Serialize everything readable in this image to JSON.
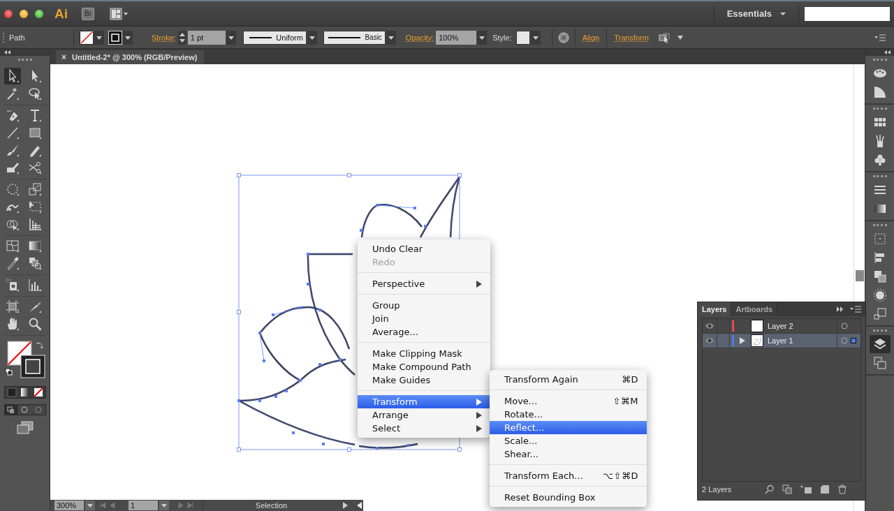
{
  "app": {
    "logo": "Ai",
    "bridge_button": "Br"
  },
  "workspace": {
    "label": "Essentials"
  },
  "control_bar": {
    "selection_label": "Path",
    "stroke_label": "Stroke:",
    "stroke_weight": "1 pt",
    "variable_width": "Uniform",
    "brush": "Basic",
    "opacity_label": "Opacity:",
    "opacity": "100%",
    "style_label": "Style:",
    "align_link": "Align",
    "transform_link": "Transform"
  },
  "tool_groups": [
    {
      "tools": [
        {
          "kind": "selection",
          "selected": true
        },
        {
          "kind": "direct-selection",
          "selected": false
        },
        {
          "kind": "magic-wand",
          "selected": false
        },
        {
          "kind": "lasso",
          "selected": false
        }
      ]
    },
    {
      "tools": [
        {
          "kind": "pen",
          "selected": false
        },
        {
          "kind": "type",
          "selected": false
        },
        {
          "kind": "line",
          "selected": false
        },
        {
          "kind": "rectangle",
          "selected": false
        },
        {
          "kind": "paintbrush",
          "selected": false
        },
        {
          "kind": "pencil",
          "selected": false
        },
        {
          "kind": "blob-brush",
          "selected": false
        },
        {
          "kind": "scissors",
          "selected": false
        }
      ]
    },
    {
      "tools": [
        {
          "kind": "rotate",
          "selected": false
        },
        {
          "kind": "scale",
          "selected": false
        },
        {
          "kind": "warp",
          "selected": false
        },
        {
          "kind": "free-transform",
          "selected": false
        },
        {
          "kind": "shape-builder",
          "selected": false
        },
        {
          "kind": "perspective-grid",
          "selected": false
        }
      ]
    },
    {
      "tools": [
        {
          "kind": "mesh",
          "selected": false
        },
        {
          "kind": "gradient",
          "selected": false
        },
        {
          "kind": "eyedropper",
          "selected": false
        },
        {
          "kind": "blend",
          "selected": false
        }
      ]
    },
    {
      "tools": [
        {
          "kind": "symbol-sprayer",
          "selected": false
        },
        {
          "kind": "column-graph",
          "selected": false
        }
      ]
    },
    {
      "tools": [
        {
          "kind": "artboard",
          "selected": false
        },
        {
          "kind": "slice",
          "selected": false
        },
        {
          "kind": "hand",
          "selected": false
        },
        {
          "kind": "zoom",
          "selected": false
        }
      ]
    }
  ],
  "document_tab": {
    "close": "×",
    "title": "Untitled-2* @ 300% (RGB/Preview)"
  },
  "context_menu": {
    "groups": [
      {
        "items": [
          {
            "label": "Undo Clear",
            "disabled": false,
            "submenu": false,
            "selected": false
          },
          {
            "label": "Redo",
            "disabled": true,
            "submenu": false,
            "selected": false
          }
        ]
      },
      {
        "items": [
          {
            "label": "Perspective",
            "disabled": false,
            "submenu": true,
            "selected": false
          }
        ]
      },
      {
        "items": [
          {
            "label": "Group",
            "disabled": false,
            "submenu": false,
            "selected": false
          },
          {
            "label": "Join",
            "disabled": false,
            "submenu": false,
            "selected": false
          },
          {
            "label": "Average...",
            "disabled": false,
            "submenu": false,
            "selected": false
          }
        ]
      },
      {
        "items": [
          {
            "label": "Make Clipping Mask",
            "disabled": false,
            "submenu": false,
            "selected": false
          },
          {
            "label": "Make Compound Path",
            "disabled": false,
            "submenu": false,
            "selected": false
          },
          {
            "label": "Make Guides",
            "disabled": false,
            "submenu": false,
            "selected": false
          }
        ]
      },
      {
        "items": [
          {
            "label": "Transform",
            "disabled": false,
            "submenu": true,
            "selected": true
          },
          {
            "label": "Arrange",
            "disabled": false,
            "submenu": true,
            "selected": false
          },
          {
            "label": "Select",
            "disabled": false,
            "submenu": true,
            "selected": false
          }
        ]
      }
    ]
  },
  "submenu": {
    "groups": [
      {
        "items": [
          {
            "label": "Transform Again",
            "shortcut": "⌘D",
            "selected": false
          }
        ]
      },
      {
        "items": [
          {
            "label": "Move...",
            "shortcut": "⇧⌘M",
            "selected": false
          },
          {
            "label": "Rotate...",
            "selected": false
          },
          {
            "label": "Reflect...",
            "selected": true
          },
          {
            "label": "Scale...",
            "selected": false
          },
          {
            "label": "Shear...",
            "selected": false
          }
        ]
      },
      {
        "items": [
          {
            "label": "Transform Each...",
            "shortcut": "⌥⇧⌘D",
            "selected": false
          }
        ]
      },
      {
        "items": [
          {
            "label": "Reset Bounding Box",
            "selected": false
          }
        ]
      }
    ]
  },
  "layers_panel": {
    "tabs": [
      {
        "label": "Layers",
        "selected": true
      },
      {
        "label": "Artboards",
        "selected": false
      }
    ],
    "layers": [
      {
        "name": "Layer 2",
        "color": "#e84a4a",
        "visible": true,
        "expandable": false,
        "selected": false
      },
      {
        "name": "Layer 1",
        "color": "#4a7be8",
        "visible": true,
        "expandable": true,
        "selected": true
      }
    ],
    "footer": "2 Layers"
  },
  "status_bar": {
    "zoom": "300%",
    "artboard": "1",
    "tool": "Selection"
  }
}
